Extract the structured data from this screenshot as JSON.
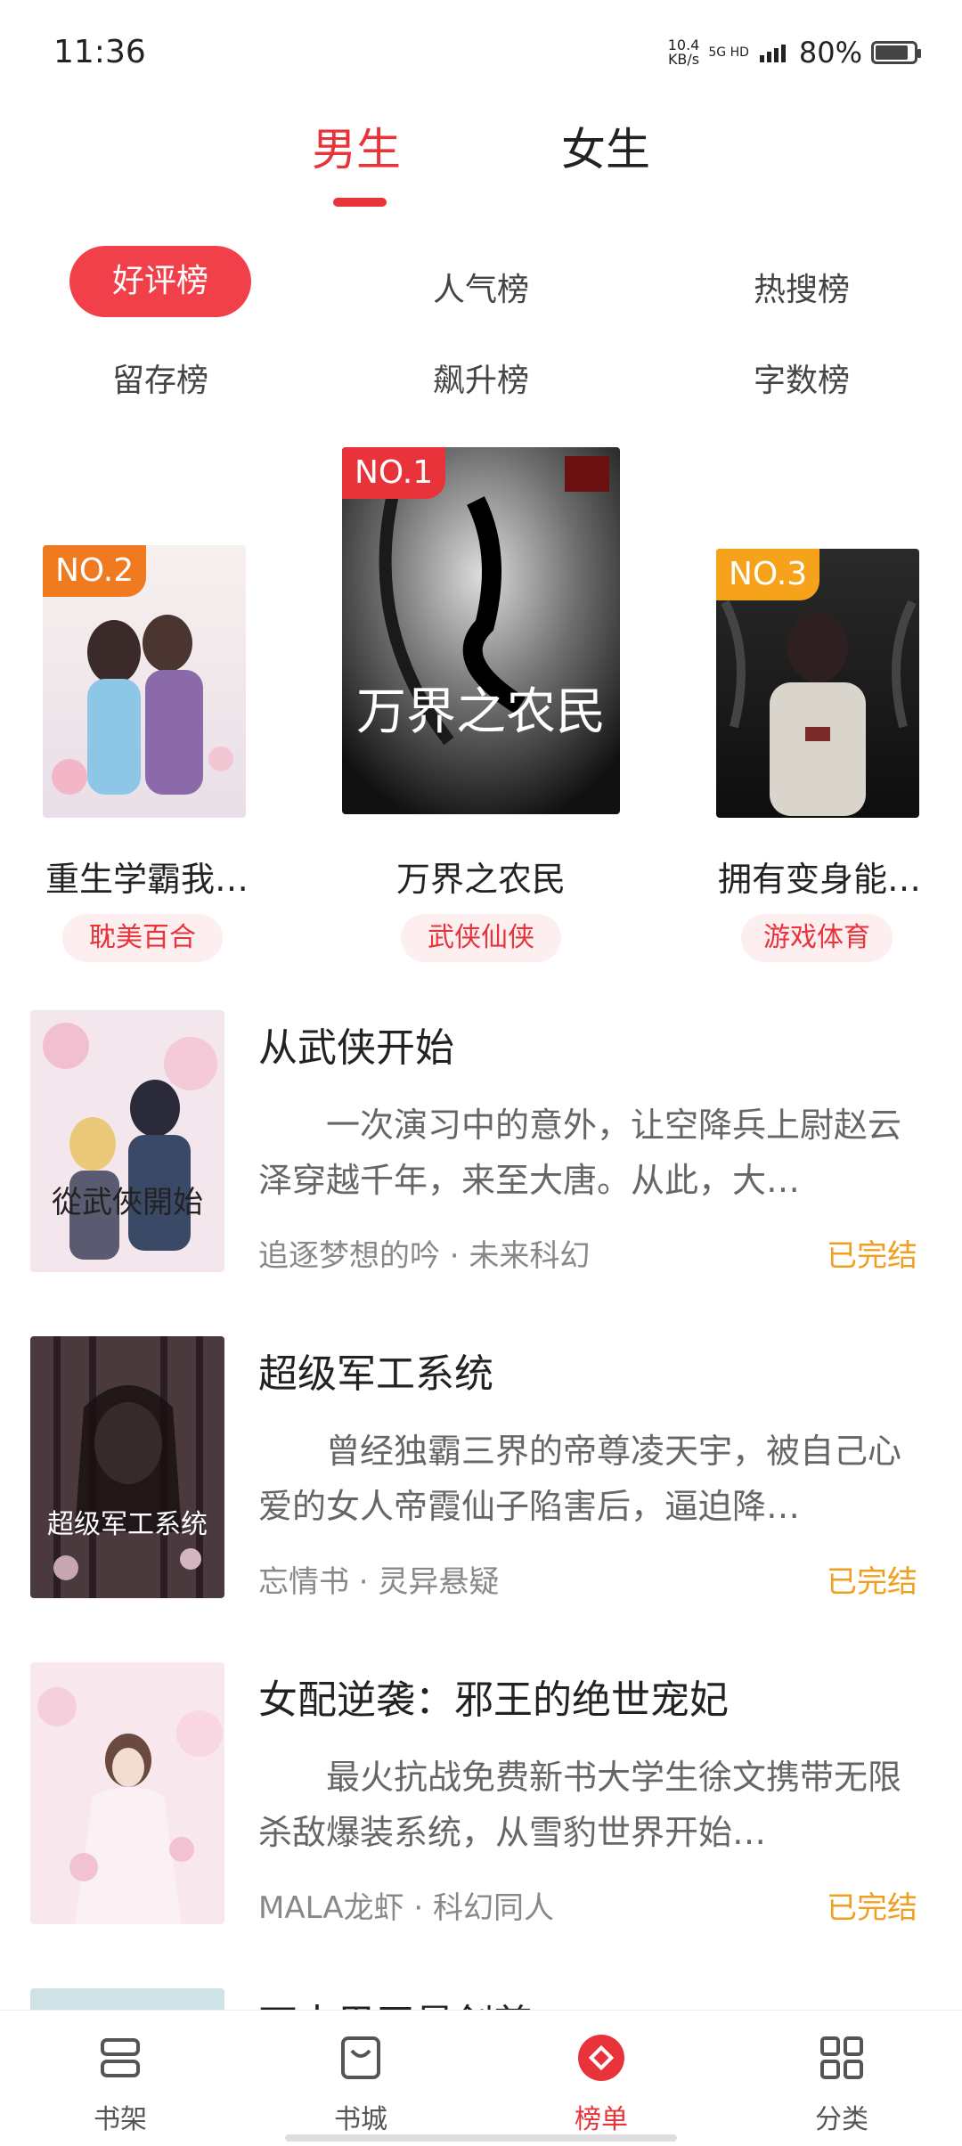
{
  "status_bar": {
    "time": "11:36",
    "net_speed_value": "10.4",
    "net_speed_unit": "KB/s",
    "signal_text": "5G HD",
    "battery": "80%"
  },
  "gender_tabs": [
    {
      "label": "男生",
      "active": true
    },
    {
      "label": "女生",
      "active": false
    }
  ],
  "rank_chips": [
    {
      "label": "好评榜",
      "active": true
    },
    {
      "label": "人气榜"
    },
    {
      "label": "热搜榜"
    },
    {
      "label": "留存榜"
    },
    {
      "label": "飙升榜"
    },
    {
      "label": "字数榜"
    }
  ],
  "podium": [
    {
      "rank": "NO.1",
      "title": "万界之农民",
      "tag": "武侠仙侠",
      "cover_text": "万界之农民"
    },
    {
      "rank": "NO.2",
      "title": "重生学霸我…",
      "tag": "耽美百合"
    },
    {
      "rank": "NO.3",
      "title": "拥有变身能…",
      "tag": "游戏体育"
    }
  ],
  "books": [
    {
      "title": "从武侠开始",
      "desc": "一次演习中的意外，让空降兵上尉赵云泽穿越千年，来至大唐。从此，大…",
      "meta": "追逐梦想的吟 · 未来科幻",
      "status": "已完结",
      "cover_text": "從武俠開始"
    },
    {
      "title": "超级军工系统",
      "desc": "曾经独霸三界的帝尊凌天宇，被自己心爱的女人帝霞仙子陷害后，逼迫降…",
      "meta": "忘情书 · 灵异悬疑",
      "status": "已完结",
      "cover_text": "超级军工系统"
    },
    {
      "title": "女配逆袭：邪王的绝世宠妃",
      "desc": "最火抗战免费新书大学生徐文携带无限杀敌爆装系统，从雪豹世界开始…",
      "meta": "MALA龙虾 · 科幻同人",
      "status": "已完结"
    },
    {
      "title": "万古男王最剑尊"
    }
  ],
  "bottom_nav": [
    {
      "label": "书架",
      "icon": "bookshelf-icon"
    },
    {
      "label": "书城",
      "icon": "bookstore-icon"
    },
    {
      "label": "榜单",
      "icon": "ranking-icon",
      "active": true
    },
    {
      "label": "分类",
      "icon": "category-icon"
    }
  ],
  "colors": {
    "accent": "#e8333a",
    "status_done": "#f0a020"
  }
}
